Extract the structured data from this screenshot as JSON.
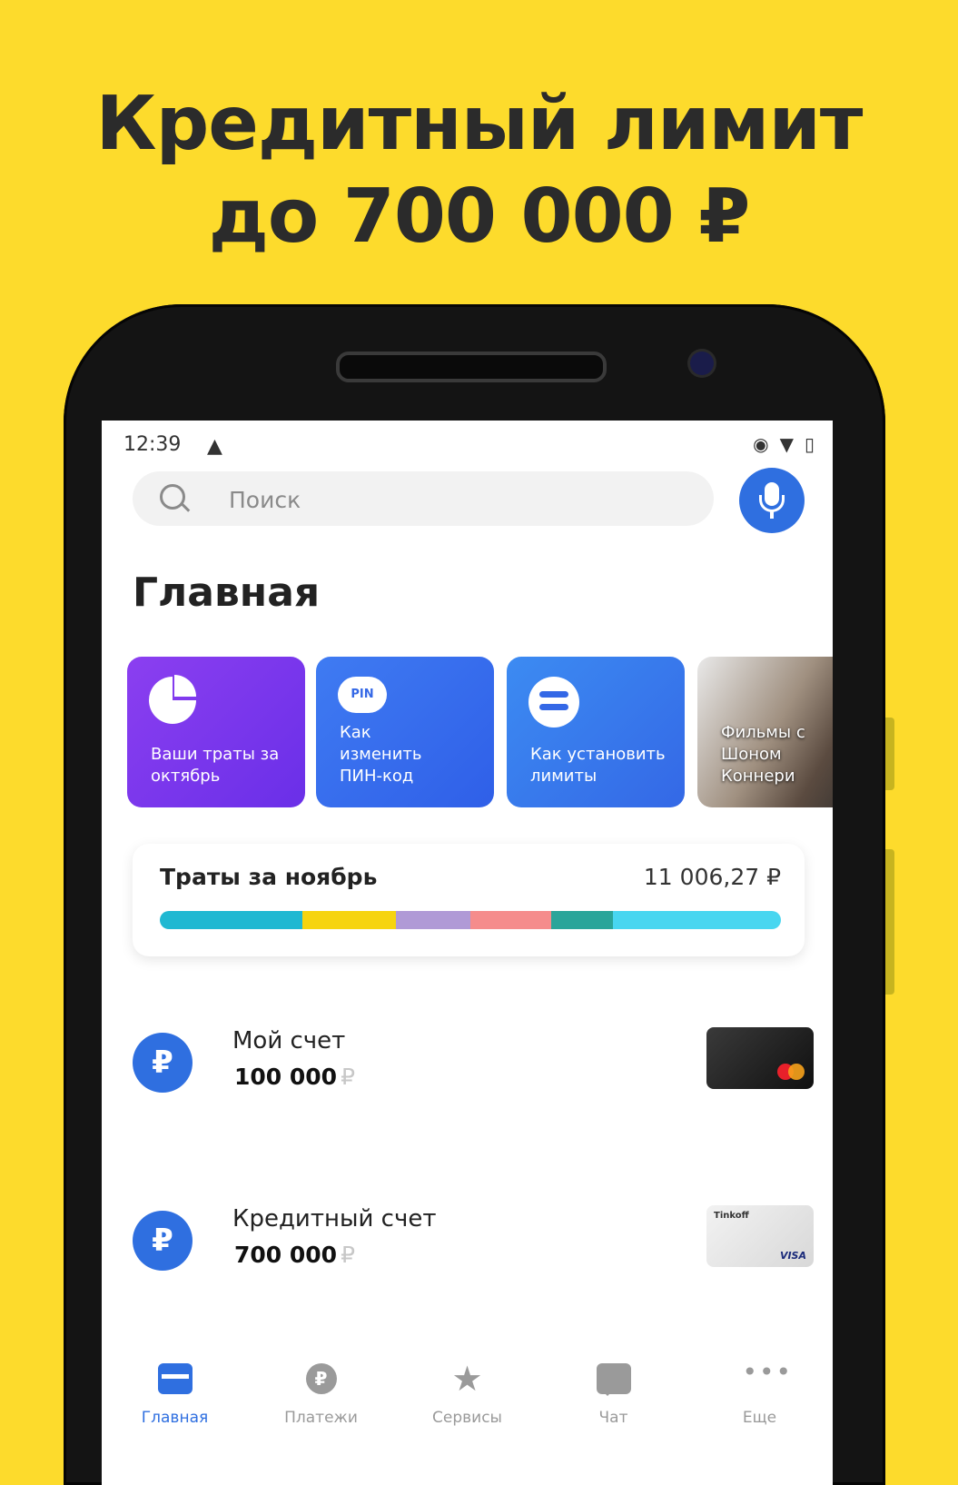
{
  "promo": {
    "line1": "Кредитный лимит",
    "line2": "до 700 000 ₽"
  },
  "statusbar": {
    "time": "12:39",
    "icons": [
      "warning-icon",
      "eye-icon",
      "wifi-icon",
      "battery-icon"
    ]
  },
  "search": {
    "placeholder": "Поиск"
  },
  "page_title": "Главная",
  "stories": [
    {
      "label": "Ваши траты за октябрь",
      "icon": "pie-chart-icon"
    },
    {
      "label": "Как изменить ПИН-код",
      "icon": "pin-icon",
      "icon_text": "PIN"
    },
    {
      "label": "Как установить лимиты",
      "icon": "limits-icon"
    },
    {
      "label": "Фильмы с Шоном Коннери",
      "icon": "movie-photo"
    }
  ],
  "spending": {
    "title": "Траты за ноябрь",
    "amount": "11 006,27 ₽",
    "segments": [
      {
        "share": 0.23,
        "color": "#1fb8d2"
      },
      {
        "share": 0.15,
        "color": "#f6d40f"
      },
      {
        "share": 0.12,
        "color": "#b09ad6"
      },
      {
        "share": 0.13,
        "color": "#f58c8c"
      },
      {
        "share": 0.1,
        "color": "#2aa59a"
      },
      {
        "share": 0.27,
        "color": "#48d6f0"
      }
    ]
  },
  "accounts": [
    {
      "name": "Мой счет",
      "balance": "100 000",
      "currency": "₽",
      "icon_text": "₽"
    },
    {
      "name": "Кредитный счет",
      "balance": "700 000",
      "currency": "₽",
      "icon_text": "₽",
      "card_brand": "Tinkoff",
      "card_network": "VISA"
    }
  ],
  "tabs": [
    {
      "label": "Главная",
      "icon": "home-icon",
      "active": true
    },
    {
      "label": "Платежи",
      "icon": "payments-icon",
      "icon_text": "₽"
    },
    {
      "label": "Сервисы",
      "icon": "star-icon",
      "icon_text": "★"
    },
    {
      "label": "Чат",
      "icon": "chat-icon"
    },
    {
      "label": "Еще",
      "icon": "more-icon",
      "icon_text": "•••"
    }
  ],
  "colors": {
    "background": "#fddb2c",
    "accent": "#2f6fe0"
  }
}
